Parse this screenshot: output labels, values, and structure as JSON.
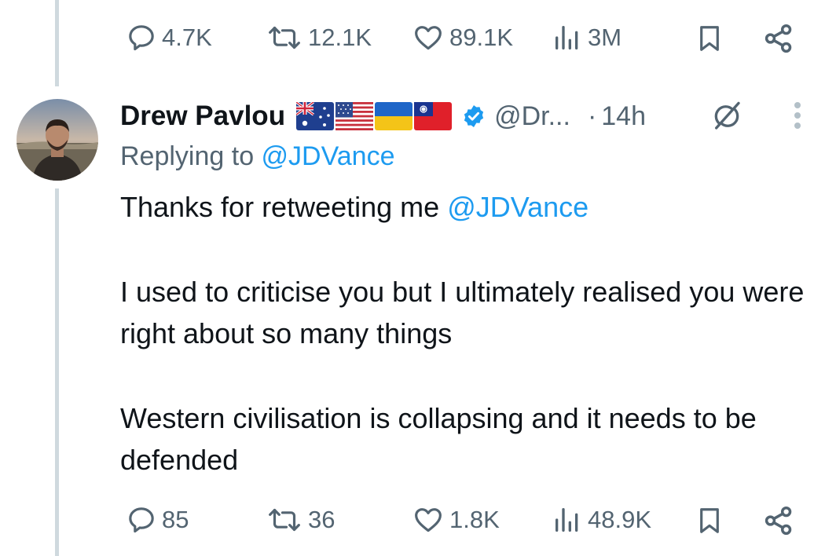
{
  "top_actions": {
    "replies": "4.7K",
    "reposts": "12.1K",
    "likes": "89.1K",
    "views": "3M"
  },
  "tweet": {
    "author": {
      "name": "Drew Pavlou",
      "handle": "@Dr...",
      "flags": [
        "australia-flag",
        "usa-flag",
        "ukraine-flag",
        "taiwan-flag"
      ],
      "verified": true
    },
    "separator": "·",
    "time": "14h",
    "replying_prefix": "Replying to ",
    "replying_to": "@JDVance",
    "body": {
      "line1_text": "Thanks for retweeting me ",
      "line1_mention": "@JDVance",
      "paragraph2": "I used to criticise you but I ultimately realised you were right about so many things",
      "paragraph3": "Western civilisation is collapsing and it needs to be defended"
    },
    "actions": {
      "replies": "85",
      "reposts": "36",
      "likes": "1.8K",
      "views": "48.9K"
    }
  },
  "colors": {
    "text": "#0f1419",
    "secondary": "#536471",
    "accent": "#1d9bf0",
    "thread_line": "#cfd9de"
  },
  "icons": [
    "reply-icon",
    "repost-icon",
    "like-icon",
    "views-icon",
    "bookmark-icon",
    "share-icon",
    "grok-icon",
    "more-icon",
    "verified-badge-icon"
  ]
}
